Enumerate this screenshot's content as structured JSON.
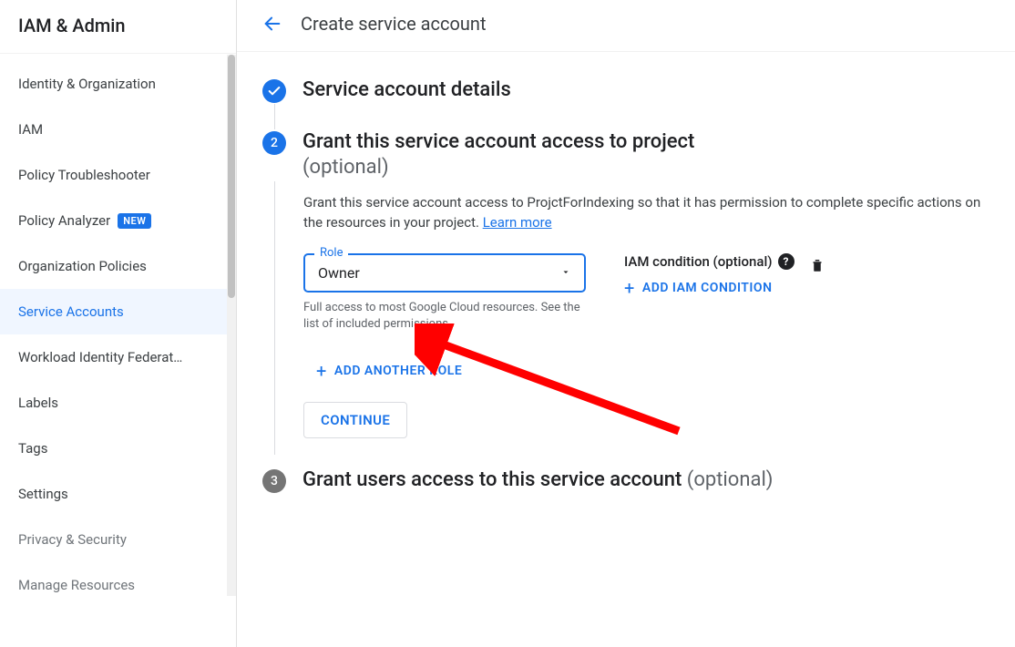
{
  "sidebar": {
    "title": "IAM & Admin",
    "items": [
      {
        "label": "Identity & Organization"
      },
      {
        "label": "IAM"
      },
      {
        "label": "Policy Troubleshooter"
      },
      {
        "label": "Policy Analyzer",
        "badge": "NEW"
      },
      {
        "label": "Organization Policies"
      },
      {
        "label": "Service Accounts",
        "active": true
      },
      {
        "label": "Workload Identity Federat…"
      },
      {
        "label": "Labels"
      },
      {
        "label": "Tags"
      },
      {
        "label": "Settings"
      },
      {
        "label": "Privacy & Security",
        "faded": true
      },
      {
        "label": "Manage Resources",
        "faded": true
      }
    ]
  },
  "header": {
    "title": "Create service account"
  },
  "steps": {
    "one": {
      "title": "Service account details"
    },
    "two": {
      "number": "2",
      "title": "Grant this service account access to project",
      "optional": "(optional)",
      "desc_prefix": "Grant this service account access to ProjctForIndexing so that it has permission to complete specific actions on the resources in your project. ",
      "learn_more": "Learn more",
      "role_label": "Role",
      "role_value": "Owner",
      "role_help": "Full access to most Google Cloud resources. See the list of included permissions.",
      "condition_label": "IAM condition (optional)",
      "add_condition": "ADD IAM CONDITION",
      "add_another": "ADD ANOTHER ROLE",
      "continue": "CONTINUE"
    },
    "three": {
      "number": "3",
      "title": "Grant users access to this service account ",
      "optional": "(optional)"
    }
  }
}
